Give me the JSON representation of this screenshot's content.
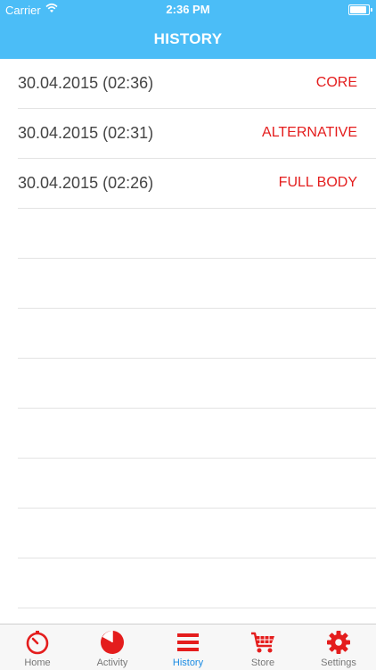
{
  "status_bar": {
    "carrier": "Carrier",
    "time": "2:36 PM"
  },
  "header": {
    "title": "HISTORY"
  },
  "history": [
    {
      "date": "30.04.2015 (02:36)",
      "workout": "CORE"
    },
    {
      "date": "30.04.2015 (02:31)",
      "workout": "ALTERNATIVE"
    },
    {
      "date": "30.04.2015 (02:26)",
      "workout": "FULL BODY"
    }
  ],
  "tabs": [
    {
      "label": "Home",
      "icon": "stopwatch-icon"
    },
    {
      "label": "Activity",
      "icon": "pie-chart-icon"
    },
    {
      "label": "History",
      "icon": "list-icon",
      "active": true
    },
    {
      "label": "Store",
      "icon": "cart-icon"
    },
    {
      "label": "Settings",
      "icon": "gear-icon"
    }
  ],
  "colors": {
    "header": "#4bbdf7",
    "accent": "#e41d1d",
    "active_tab": "#1a8be3"
  }
}
